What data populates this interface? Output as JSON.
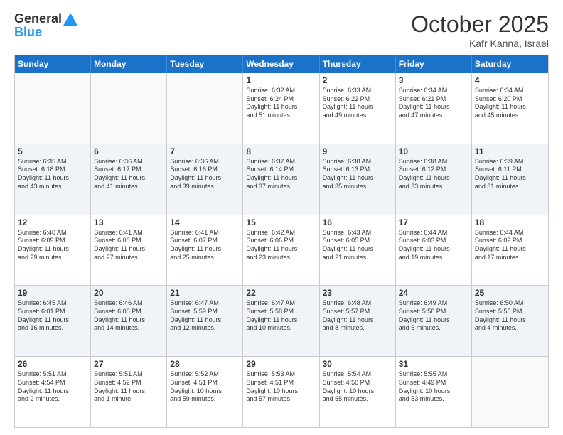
{
  "header": {
    "logo_general": "General",
    "logo_blue": "Blue",
    "month_title": "October 2025",
    "subtitle": "Kafr Kanna, Israel"
  },
  "days_of_week": [
    "Sunday",
    "Monday",
    "Tuesday",
    "Wednesday",
    "Thursday",
    "Friday",
    "Saturday"
  ],
  "rows": [
    [
      {
        "day": "",
        "info": ""
      },
      {
        "day": "",
        "info": ""
      },
      {
        "day": "",
        "info": ""
      },
      {
        "day": "1",
        "info": "Sunrise: 6:32 AM\nSunset: 6:24 PM\nDaylight: 11 hours\nand 51 minutes."
      },
      {
        "day": "2",
        "info": "Sunrise: 6:33 AM\nSunset: 6:22 PM\nDaylight: 11 hours\nand 49 minutes."
      },
      {
        "day": "3",
        "info": "Sunrise: 6:34 AM\nSunset: 6:21 PM\nDaylight: 11 hours\nand 47 minutes."
      },
      {
        "day": "4",
        "info": "Sunrise: 6:34 AM\nSunset: 6:20 PM\nDaylight: 11 hours\nand 45 minutes."
      }
    ],
    [
      {
        "day": "5",
        "info": "Sunrise: 6:35 AM\nSunset: 6:18 PM\nDaylight: 11 hours\nand 43 minutes."
      },
      {
        "day": "6",
        "info": "Sunrise: 6:36 AM\nSunset: 6:17 PM\nDaylight: 11 hours\nand 41 minutes."
      },
      {
        "day": "7",
        "info": "Sunrise: 6:36 AM\nSunset: 6:16 PM\nDaylight: 11 hours\nand 39 minutes."
      },
      {
        "day": "8",
        "info": "Sunrise: 6:37 AM\nSunset: 6:14 PM\nDaylight: 11 hours\nand 37 minutes."
      },
      {
        "day": "9",
        "info": "Sunrise: 6:38 AM\nSunset: 6:13 PM\nDaylight: 11 hours\nand 35 minutes."
      },
      {
        "day": "10",
        "info": "Sunrise: 6:38 AM\nSunset: 6:12 PM\nDaylight: 11 hours\nand 33 minutes."
      },
      {
        "day": "11",
        "info": "Sunrise: 6:39 AM\nSunset: 6:11 PM\nDaylight: 11 hours\nand 31 minutes."
      }
    ],
    [
      {
        "day": "12",
        "info": "Sunrise: 6:40 AM\nSunset: 6:09 PM\nDaylight: 11 hours\nand 29 minutes."
      },
      {
        "day": "13",
        "info": "Sunrise: 6:41 AM\nSunset: 6:08 PM\nDaylight: 11 hours\nand 27 minutes."
      },
      {
        "day": "14",
        "info": "Sunrise: 6:41 AM\nSunset: 6:07 PM\nDaylight: 11 hours\nand 25 minutes."
      },
      {
        "day": "15",
        "info": "Sunrise: 6:42 AM\nSunset: 6:06 PM\nDaylight: 11 hours\nand 23 minutes."
      },
      {
        "day": "16",
        "info": "Sunrise: 6:43 AM\nSunset: 6:05 PM\nDaylight: 11 hours\nand 21 minutes."
      },
      {
        "day": "17",
        "info": "Sunrise: 6:44 AM\nSunset: 6:03 PM\nDaylight: 11 hours\nand 19 minutes."
      },
      {
        "day": "18",
        "info": "Sunrise: 6:44 AM\nSunset: 6:02 PM\nDaylight: 11 hours\nand 17 minutes."
      }
    ],
    [
      {
        "day": "19",
        "info": "Sunrise: 6:45 AM\nSunset: 6:01 PM\nDaylight: 11 hours\nand 16 minutes."
      },
      {
        "day": "20",
        "info": "Sunrise: 6:46 AM\nSunset: 6:00 PM\nDaylight: 11 hours\nand 14 minutes."
      },
      {
        "day": "21",
        "info": "Sunrise: 6:47 AM\nSunset: 5:59 PM\nDaylight: 11 hours\nand 12 minutes."
      },
      {
        "day": "22",
        "info": "Sunrise: 6:47 AM\nSunset: 5:58 PM\nDaylight: 11 hours\nand 10 minutes."
      },
      {
        "day": "23",
        "info": "Sunrise: 6:48 AM\nSunset: 5:57 PM\nDaylight: 11 hours\nand 8 minutes."
      },
      {
        "day": "24",
        "info": "Sunrise: 6:49 AM\nSunset: 5:56 PM\nDaylight: 11 hours\nand 6 minutes."
      },
      {
        "day": "25",
        "info": "Sunrise: 6:50 AM\nSunset: 5:55 PM\nDaylight: 11 hours\nand 4 minutes."
      }
    ],
    [
      {
        "day": "26",
        "info": "Sunrise: 5:51 AM\nSunset: 4:54 PM\nDaylight: 11 hours\nand 2 minutes."
      },
      {
        "day": "27",
        "info": "Sunrise: 5:51 AM\nSunset: 4:52 PM\nDaylight: 11 hours\nand 1 minute."
      },
      {
        "day": "28",
        "info": "Sunrise: 5:52 AM\nSunset: 4:51 PM\nDaylight: 10 hours\nand 59 minutes."
      },
      {
        "day": "29",
        "info": "Sunrise: 5:53 AM\nSunset: 4:51 PM\nDaylight: 10 hours\nand 57 minutes."
      },
      {
        "day": "30",
        "info": "Sunrise: 5:54 AM\nSunset: 4:50 PM\nDaylight: 10 hours\nand 55 minutes."
      },
      {
        "day": "31",
        "info": "Sunrise: 5:55 AM\nSunset: 4:49 PM\nDaylight: 10 hours\nand 53 minutes."
      },
      {
        "day": "",
        "info": ""
      }
    ]
  ]
}
